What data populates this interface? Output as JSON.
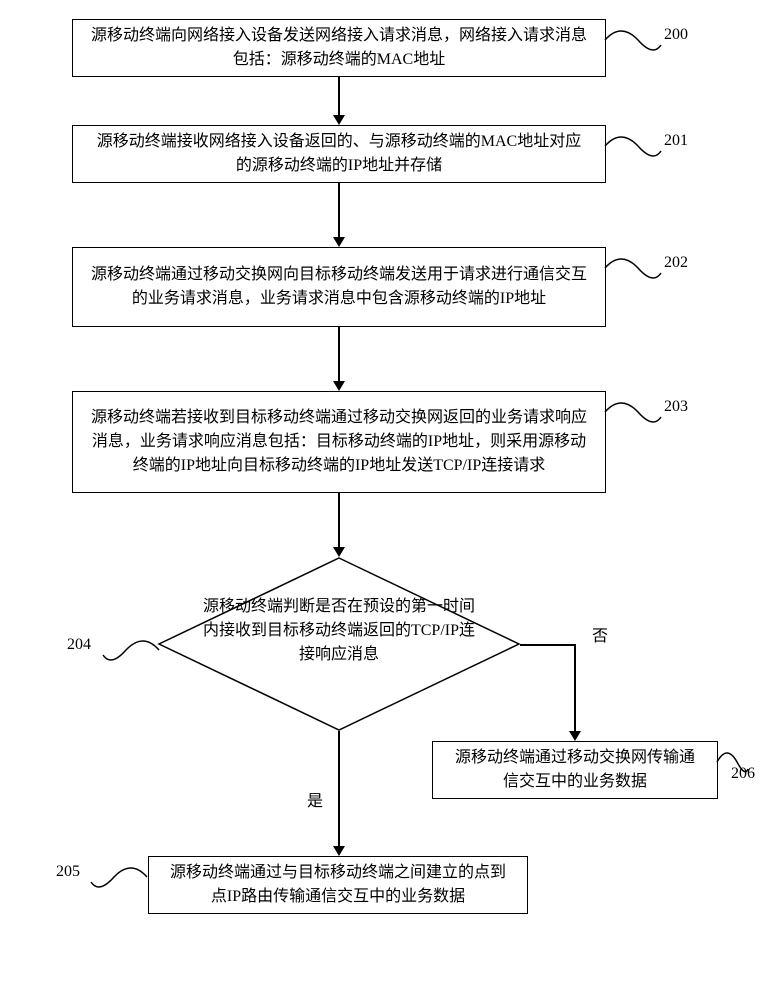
{
  "steps": {
    "s200": {
      "text": "源移动终端向网络接入设备发送网络接入请求消息，网络接入请求消息包括：源移动终端的MAC地址",
      "num": "200"
    },
    "s201": {
      "text": "源移动终端接收网络接入设备返回的、与源移动终端的MAC地址对应的源移动终端的IP地址并存储",
      "num": "201"
    },
    "s202": {
      "text": "源移动终端通过移动交换网向目标移动终端发送用于请求进行通信交互的业务请求消息，业务请求消息中包含源移动终端的IP地址",
      "num": "202"
    },
    "s203": {
      "text": "源移动终端若接收到目标移动终端通过移动交换网返回的业务请求响应消息，业务请求响应消息包括：目标移动终端的IP地址，则采用源移动终端的IP地址向目标移动终端的IP地址发送TCP/IP连接请求",
      "num": "203"
    },
    "s204": {
      "text": "源移动终端判断是否在预设的第一时间内接收到目标移动终端返回的TCP/IP连接响应消息",
      "num": "204"
    },
    "s205": {
      "text": "源移动终端通过与目标移动终端之间建立的点到点IP路由传输通信交互中的业务数据",
      "num": "205"
    },
    "s206": {
      "text": "源移动终端通过移动交换网传输通信交互中的业务数据",
      "num": "206"
    }
  },
  "labels": {
    "yes": "是",
    "no": "否"
  }
}
